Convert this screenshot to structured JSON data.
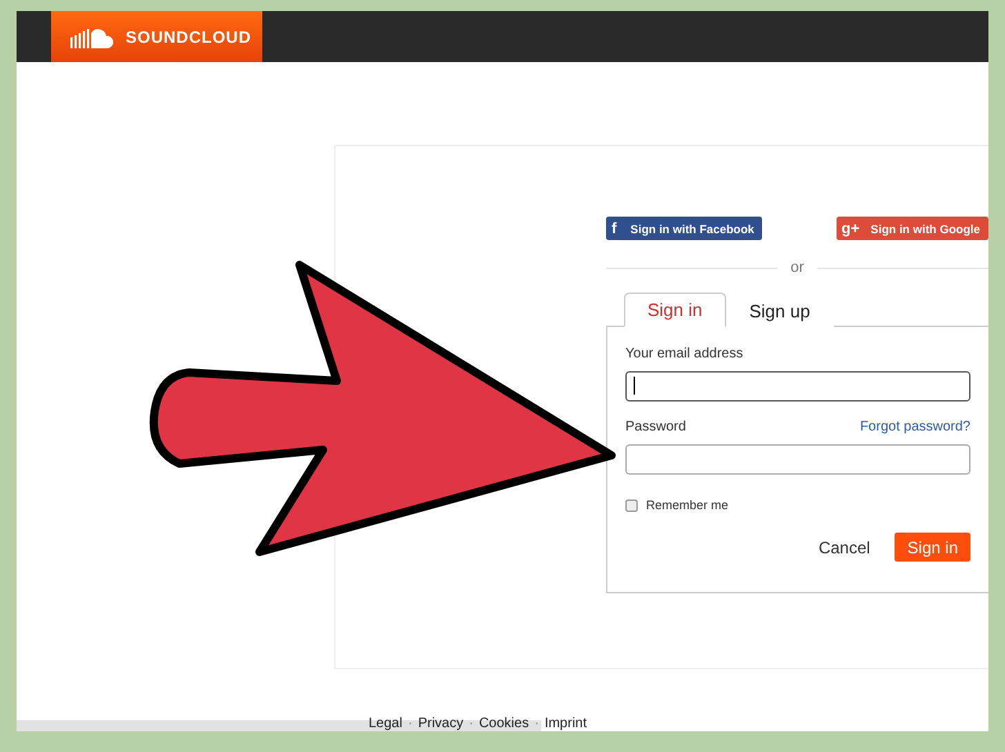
{
  "logo": {
    "text": "SOUNDCLOUD"
  },
  "social_buttons": [
    {
      "kind": "facebook",
      "icon_text": "f",
      "label": "Sign in with Facebook"
    },
    {
      "kind": "google",
      "icon_text": "g+",
      "label": "Sign in with Google"
    }
  ],
  "divider_text": "or",
  "tabs": [
    {
      "label": "Sign in",
      "selected": true
    },
    {
      "label": "Sign up",
      "selected": false
    }
  ],
  "form": {
    "email_label": "Your email address",
    "email_focused": true,
    "password_label": "Password",
    "forgot_link": "Forgot password?",
    "remember": {
      "label": "Remember me",
      "checked": false
    },
    "cancel": "Cancel",
    "submit": "Sign in"
  },
  "footer": {
    "links": [
      "Legal",
      "Privacy",
      "Cookies",
      "Imprint"
    ],
    "separator": "·"
  }
}
